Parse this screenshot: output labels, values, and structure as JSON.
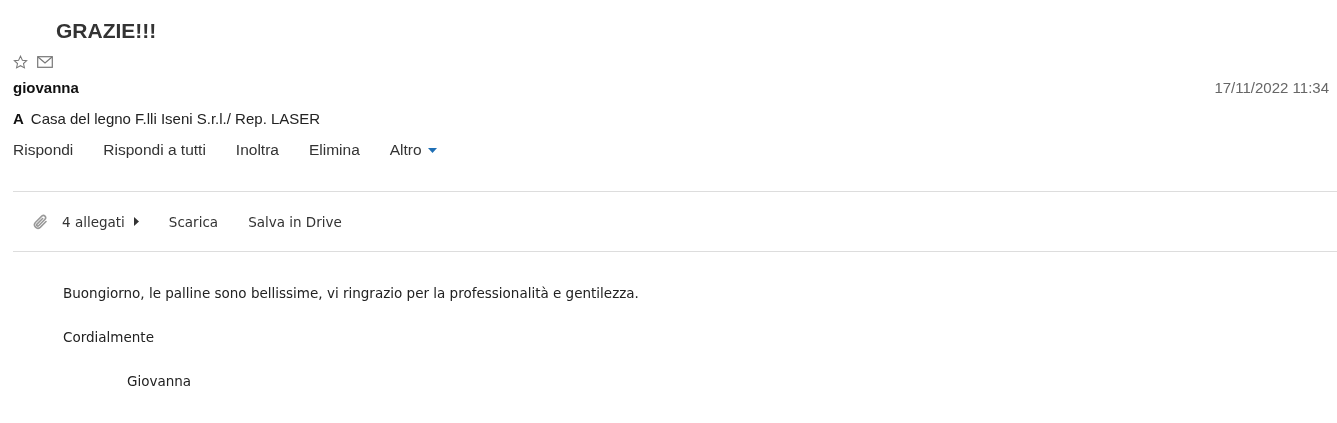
{
  "subject": "GRAZIE!!!",
  "flags": {
    "starred": false
  },
  "sender": "giovanna",
  "date": "17/11/2022 11:34",
  "recipients": {
    "label": "A",
    "value": "Casa del legno F.lli Iseni S.r.l./ Rep. LASER"
  },
  "actions": [
    {
      "label": "Rispondi",
      "kind": "plain"
    },
    {
      "label": "Rispondi a tutti",
      "kind": "plain"
    },
    {
      "label": "Inoltra",
      "kind": "plain"
    },
    {
      "label": "Elimina",
      "kind": "plain"
    },
    {
      "label": "Altro",
      "kind": "menu"
    }
  ],
  "attachments": {
    "count": "4 allegati",
    "actions": [
      "Scarica",
      "Salva in Drive"
    ]
  },
  "body": [
    {
      "kind": "paragraph",
      "text": "Buongiorno, le palline sono bellissime, vi ringrazio per la professionalità e gentilezza."
    },
    {
      "kind": "paragraph",
      "text": "Cordialmente"
    },
    {
      "kind": "signature",
      "text": "Giovanna"
    }
  ]
}
